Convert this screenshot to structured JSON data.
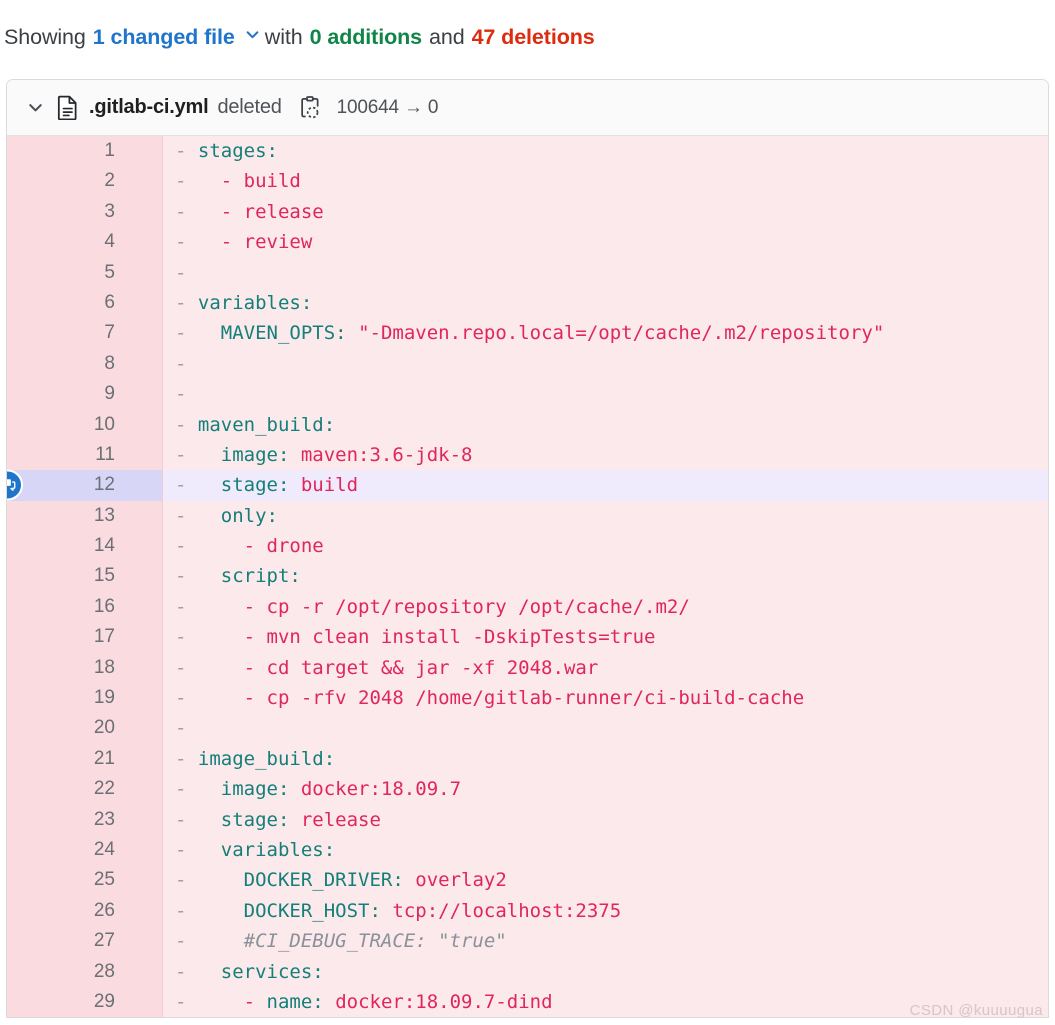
{
  "summary": {
    "prefix": "Showing",
    "changed_files": "1 changed file",
    "chevron": "chevron-down-icon",
    "with": "with",
    "additions": "0 additions",
    "and": "and",
    "deletions": "47 deletions"
  },
  "file": {
    "chevron": "chevron-down-icon",
    "doc_icon": "file-document-icon",
    "name": ".gitlab-ci.yml",
    "state": "deleted",
    "copy_icon": "copy-path-icon",
    "mode": "100644 → 0"
  },
  "colors": {
    "link": "#1f75cb",
    "additions": "#108548",
    "deletions": "#dd2b0e",
    "diff_bg": "#fbe9eb",
    "gutter_bg": "#fadbdf",
    "highlight_gutter": "#d7d6f7",
    "highlight_code": "#efeafc",
    "key": "#147f78",
    "value": "#e0265c",
    "comment": "#8a9199"
  },
  "diff": {
    "marker": "-",
    "comment_button": "add-comment-icon",
    "highlighted_line": 12,
    "lines": [
      {
        "n": 1,
        "parts": [
          {
            "t": "stages",
            "c": "k"
          },
          {
            "t": ":",
            "c": "k"
          }
        ]
      },
      {
        "n": 2,
        "parts": [
          {
            "t": "  - ",
            "c": "v"
          },
          {
            "t": "build",
            "c": "v"
          }
        ]
      },
      {
        "n": 3,
        "parts": [
          {
            "t": "  - ",
            "c": "v"
          },
          {
            "t": "release",
            "c": "v"
          }
        ]
      },
      {
        "n": 4,
        "parts": [
          {
            "t": "  - ",
            "c": "v"
          },
          {
            "t": "review",
            "c": "v"
          }
        ]
      },
      {
        "n": 5,
        "parts": []
      },
      {
        "n": 6,
        "parts": [
          {
            "t": "variables",
            "c": "k"
          },
          {
            "t": ":",
            "c": "k"
          }
        ]
      },
      {
        "n": 7,
        "parts": [
          {
            "t": "  MAVEN_OPTS",
            "c": "k"
          },
          {
            "t": ": ",
            "c": "k"
          },
          {
            "t": "\"-Dmaven.repo.local=/opt/cache/.m2/repository\"",
            "c": "v"
          }
        ]
      },
      {
        "n": 8,
        "parts": []
      },
      {
        "n": 9,
        "parts": []
      },
      {
        "n": 10,
        "parts": [
          {
            "t": "maven_build",
            "c": "k"
          },
          {
            "t": ":",
            "c": "k"
          }
        ]
      },
      {
        "n": 11,
        "parts": [
          {
            "t": "  image",
            "c": "k"
          },
          {
            "t": ": ",
            "c": "k"
          },
          {
            "t": "maven:3.6-jdk-8",
            "c": "v"
          }
        ]
      },
      {
        "n": 12,
        "parts": [
          {
            "t": "  stage",
            "c": "k"
          },
          {
            "t": ": ",
            "c": "k"
          },
          {
            "t": "build",
            "c": "v"
          }
        ]
      },
      {
        "n": 13,
        "parts": [
          {
            "t": "  only",
            "c": "k"
          },
          {
            "t": ":",
            "c": "k"
          }
        ]
      },
      {
        "n": 14,
        "parts": [
          {
            "t": "    - ",
            "c": "v"
          },
          {
            "t": "drone",
            "c": "v"
          }
        ]
      },
      {
        "n": 15,
        "parts": [
          {
            "t": "  script",
            "c": "k"
          },
          {
            "t": ":",
            "c": "k"
          }
        ]
      },
      {
        "n": 16,
        "parts": [
          {
            "t": "    - cp -r /opt/repository /opt/cache/.m2/",
            "c": "v"
          }
        ]
      },
      {
        "n": 17,
        "parts": [
          {
            "t": "    - mvn clean install -DskipTests=true",
            "c": "v"
          }
        ]
      },
      {
        "n": 18,
        "parts": [
          {
            "t": "    - cd target && jar -xf 2048.war",
            "c": "v"
          }
        ]
      },
      {
        "n": 19,
        "parts": [
          {
            "t": "    - cp -rfv 2048 /home/gitlab-runner/ci-build-cache",
            "c": "v"
          }
        ]
      },
      {
        "n": 20,
        "parts": []
      },
      {
        "n": 21,
        "parts": [
          {
            "t": "image_build",
            "c": "k"
          },
          {
            "t": ":",
            "c": "k"
          }
        ]
      },
      {
        "n": 22,
        "parts": [
          {
            "t": "  image",
            "c": "k"
          },
          {
            "t": ": ",
            "c": "k"
          },
          {
            "t": "docker:18.09.7",
            "c": "v"
          }
        ]
      },
      {
        "n": 23,
        "parts": [
          {
            "t": "  stage",
            "c": "k"
          },
          {
            "t": ": ",
            "c": "k"
          },
          {
            "t": "release",
            "c": "v"
          }
        ]
      },
      {
        "n": 24,
        "parts": [
          {
            "t": "  variables",
            "c": "k"
          },
          {
            "t": ":",
            "c": "k"
          }
        ]
      },
      {
        "n": 25,
        "parts": [
          {
            "t": "    DOCKER_DRIVER",
            "c": "k"
          },
          {
            "t": ": ",
            "c": "k"
          },
          {
            "t": "overlay2",
            "c": "v"
          }
        ]
      },
      {
        "n": 26,
        "parts": [
          {
            "t": "    DOCKER_HOST",
            "c": "k"
          },
          {
            "t": ": ",
            "c": "k"
          },
          {
            "t": "tcp://localhost:2375",
            "c": "v"
          }
        ]
      },
      {
        "n": 27,
        "parts": [
          {
            "t": "    #CI_DEBUG_TRACE: \"true\"",
            "c": "cm"
          }
        ]
      },
      {
        "n": 28,
        "parts": [
          {
            "t": "  services",
            "c": "k"
          },
          {
            "t": ":",
            "c": "k"
          }
        ]
      },
      {
        "n": 29,
        "parts": [
          {
            "t": "    - ",
            "c": "v"
          },
          {
            "t": "name",
            "c": "k"
          },
          {
            "t": ": ",
            "c": "k"
          },
          {
            "t": "docker:18.09.7-dind",
            "c": "v"
          }
        ]
      }
    ]
  },
  "watermark": "CSDN @kuuuugua"
}
